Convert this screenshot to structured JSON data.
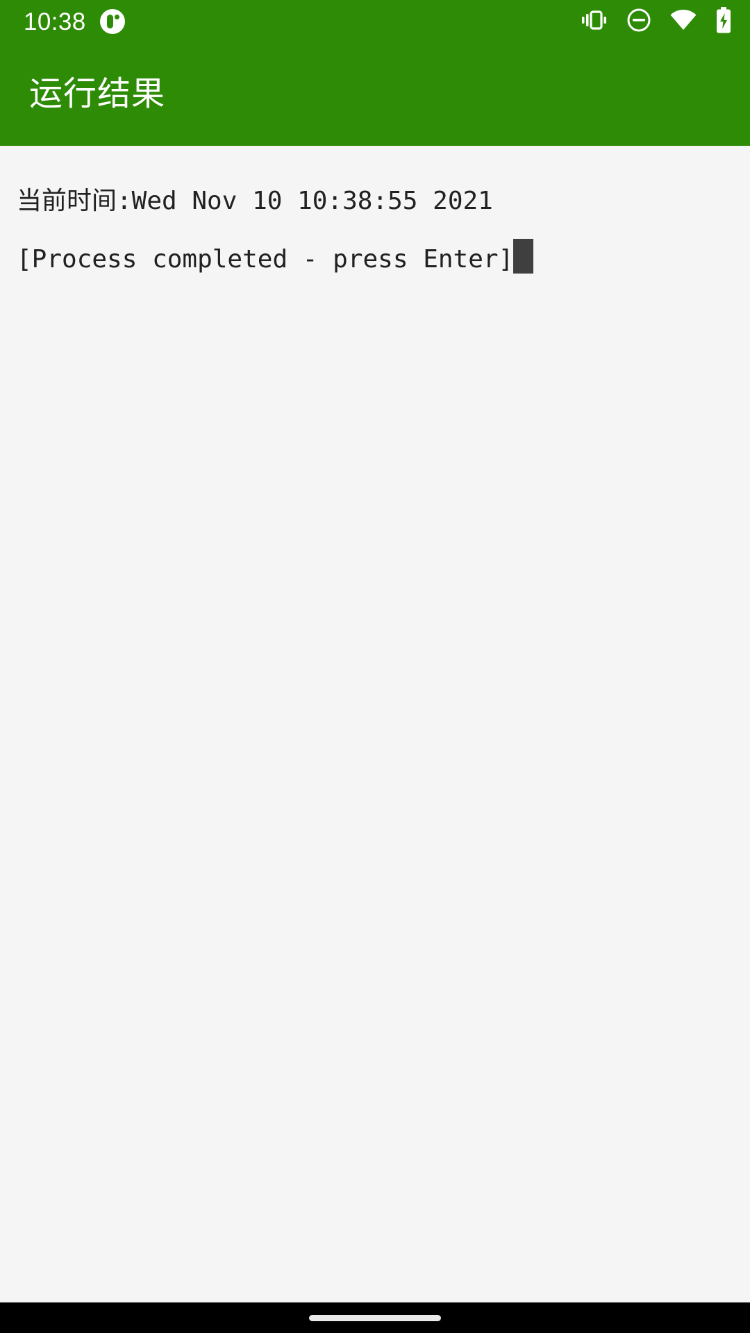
{
  "status_bar": {
    "clock": "10:38",
    "notification_icon": "app-notification-badge-icon",
    "icons": [
      {
        "name": "vibrate-icon",
        "label": "vibrate"
      },
      {
        "name": "do-not-disturb-icon",
        "label": "do not disturb"
      },
      {
        "name": "wifi-icon",
        "label": "wifi"
      },
      {
        "name": "battery-charging-icon",
        "label": "battery charging"
      }
    ],
    "background_color": "#2e8b06",
    "foreground_color": "#ffffff"
  },
  "app_bar": {
    "title": "运行结果",
    "background_color": "#2e8b06",
    "title_color": "#ffffff"
  },
  "console": {
    "background_color": "#f4f5f4",
    "text_color": "#212121",
    "cursor_color": "#3f3f3f",
    "lines": [
      {
        "text": "当前时间:Wed Nov 10 10:38:55 2021",
        "cursor": false
      },
      {
        "text": "[Process completed - press Enter]",
        "cursor": true
      }
    ]
  },
  "nav_bar": {
    "gesture_pill": "home-gesture-pill",
    "background_color": "#000000",
    "pill_color": "#e9e9e9"
  }
}
